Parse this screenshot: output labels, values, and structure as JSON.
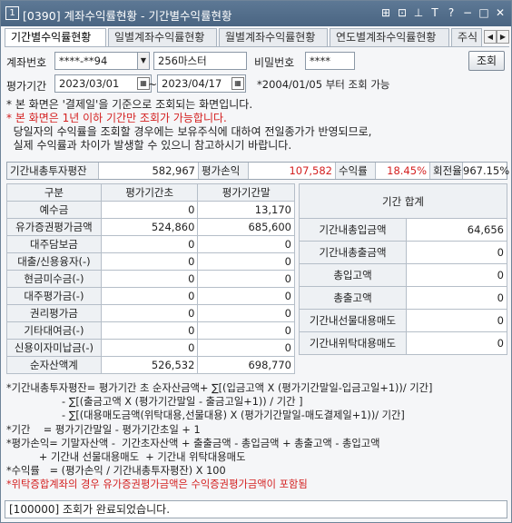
{
  "window": {
    "number": "1",
    "title": "[0390] 계좌수익률현황 - 기간별수익률현황",
    "icons": [
      "link-icon",
      "lock-icon",
      "pin-icon",
      "text-size-icon",
      "help-icon",
      "minimize-icon",
      "maximize-icon",
      "close-icon"
    ],
    "icon_glyphs": [
      "⊞",
      "⊡",
      "⊥",
      "T",
      "?",
      "−",
      "□",
      "✕"
    ]
  },
  "tabs": [
    {
      "label": "기간별수익률현황",
      "active": true
    },
    {
      "label": "일별계좌수익률현황",
      "active": false
    },
    {
      "label": "월별계좌수익률현황",
      "active": false
    },
    {
      "label": "연도별계좌수익률현황",
      "active": false
    },
    {
      "label": "주식",
      "active": false
    }
  ],
  "tab_arrows": [
    "◀",
    "▶"
  ],
  "form": {
    "account_label": "계좌번호",
    "account_value": "****-**94",
    "account_name": "256마스터",
    "password_label": "비밀번호",
    "password_value": "****",
    "search_button": "조회",
    "period_label": "평가기간",
    "start_date": "2023/03/01",
    "end_date": "2023/04/17",
    "date_sep": "~",
    "period_note": "*2004/01/05 부터 조회 가능"
  },
  "notes": {
    "line1": "* 본 화면은 '결제일'을 기준으로 조회되는 화면입니다.",
    "line2": "* 본 화면은 1년 이하 기간만 조회가 가능합니다.",
    "line3": "  당일자의 수익률을 조회할 경우에는 보유주식에 대하여 전일종가가 반영되므로,",
    "line4": "  실제 수익률과 차이가 발생할 수 있으니 참고하시기 바랍니다."
  },
  "summary": {
    "avg_invest_label": "기간내총투자평잔",
    "avg_invest_value": "582,967",
    "pnl_label": "평가손익",
    "pnl_value": "107,582",
    "return_label": "수익률",
    "return_value": "18.45%",
    "turnover_label": "회전율",
    "turnover_value": "967.15%"
  },
  "left_table": {
    "headers": [
      "구분",
      "평가기간초",
      "평가기간말"
    ],
    "rows": [
      {
        "label": "예수금",
        "start": "0",
        "end": "13,170"
      },
      {
        "label": "유가증권평가금액",
        "start": "524,860",
        "end": "685,600"
      },
      {
        "label": "대주담보금",
        "start": "0",
        "end": "0"
      },
      {
        "label": "대출/신용융자(-)",
        "start": "0",
        "end": "0"
      },
      {
        "label": "현금미수금(-)",
        "start": "0",
        "end": "0"
      },
      {
        "label": "대주평가금(-)",
        "start": "0",
        "end": "0"
      },
      {
        "label": "권리평가금",
        "start": "0",
        "end": "0"
      },
      {
        "label": "기타대여금(-)",
        "start": "0",
        "end": "0"
      },
      {
        "label": "신용이자미납금(-)",
        "start": "0",
        "end": "0"
      }
    ],
    "total": {
      "label": "순자산액계",
      "start": "526,532",
      "end": "698,770"
    }
  },
  "right_table": {
    "title": "기간 합계",
    "rows": [
      {
        "label": "기간내총입금액",
        "value": "64,656"
      },
      {
        "label": "기간내총출금액",
        "value": "0"
      },
      {
        "label": "총입고액",
        "value": "0"
      },
      {
        "label": "총출고액",
        "value": "0"
      },
      {
        "label": "기간내선물대용매도",
        "value": "0"
      },
      {
        "label": "기간내위탁대용매도",
        "value": "0"
      }
    ]
  },
  "formula": {
    "l1": "*기간내총투자평잔= 평가기간 초 순자산금액+ ∑[(입금고액 X (평가기간말일-입금고일+1))/ 기간]",
    "l2": "                 - ∑[(출금고액 X (평가기간말일 - 출금고일+1)) / 기간 ]",
    "l3": "                 - ∑[(대용매도금액(위탁대용,선물대용) X (평가기간말일-매도결제일+1))/ 기간]",
    "l4": "*기간    = 평가기간말일 - 평가기간초일 + 1",
    "l5": "*평가손익= 기말자산액 -  기간초자산액 + 출출금액 - 총입금액 + 총출고액 - 총입고액",
    "l6": "          + 기간내 선물대용매도  + 기간내 위탁대용매도",
    "l7": "*수익률   = (평가손익 / 기간내총투자평잔) X 100",
    "l8": "*위탁증합계좌의 경우 유가증권평가금액은 수익증권평가금액이 포함됨"
  },
  "status": "[100000] 조회가 완료되었습니다."
}
